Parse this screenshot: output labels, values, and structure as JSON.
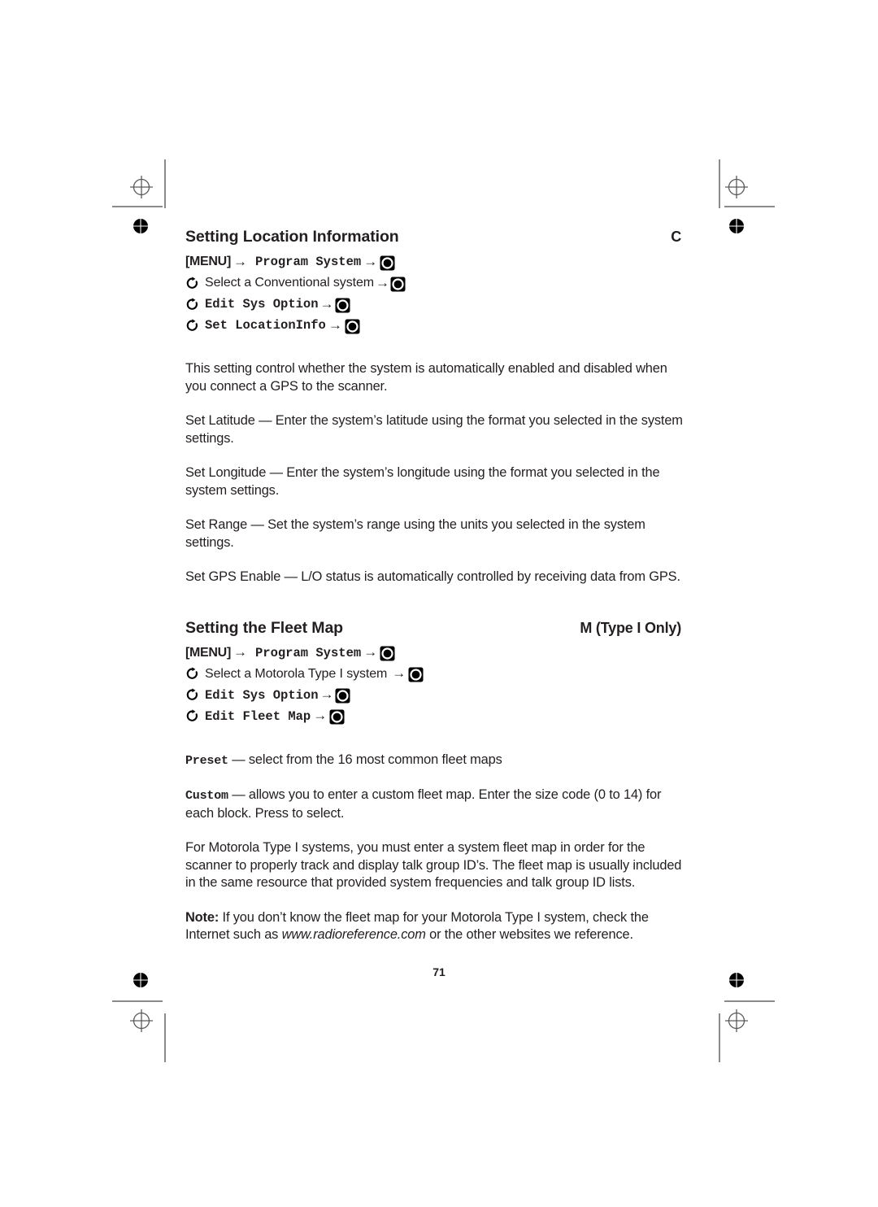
{
  "page": {
    "number": "71"
  },
  "sections": [
    {
      "title": "Setting Location Information",
      "tag": "C",
      "navpath": [
        {
          "lead": "[MENU]",
          "lead_style": "menu",
          "label": "Program System",
          "label_style": "mono"
        },
        {
          "lead": "rotate-icon",
          "lead_style": "icon",
          "label": "Select a Conventional system",
          "label_style": "plain"
        },
        {
          "lead": "rotate-icon",
          "lead_style": "icon",
          "label": "Edit Sys Option",
          "label_style": "mono"
        },
        {
          "lead": "rotate-icon",
          "lead_style": "icon",
          "label": "Set LocationInfo",
          "label_style": "mono"
        }
      ],
      "paragraphs": [
        "This setting control whether the system is automatically enabled and disabled when you connect a GPS to the scanner.",
        "Set Latitude — Enter the system’s latitude using the format you selected in the system settings.",
        "Set Longitude — Enter the system’s longitude using the format you selected in the system settings.",
        "Set Range — Set the system’s range using the units you selected in the system settings.",
        "Set GPS Enable — L/O status is automatically controlled by receiving data from GPS."
      ]
    },
    {
      "title": "Setting the Fleet Map",
      "tag": "M (Type I Only)",
      "navpath": [
        {
          "lead": "[MENU]",
          "lead_style": "menu",
          "label": "Program System",
          "label_style": "mono"
        },
        {
          "lead": "rotate-icon",
          "lead_style": "icon",
          "label": "Select a Motorola Type I system",
          "label_style": "plain"
        },
        {
          "lead": "rotate-icon",
          "lead_style": "icon",
          "label": "Edit Sys Option",
          "label_style": "mono"
        },
        {
          "lead": "rotate-icon",
          "lead_style": "icon",
          "label": "Edit Fleet Map",
          "label_style": "mono"
        }
      ],
      "definitions": [
        {
          "term": "Preset",
          "text": " — select from the 16 most common fleet maps"
        },
        {
          "term": "Custom",
          "text": " — allows you to enter a custom fleet map. Enter the size code (0 to 14) for each block. Press  to select."
        }
      ],
      "paragraphs": [
        "For Motorola Type I systems, you must enter a system fleet map in order for the scanner to properly track and display talk group ID’s. The fleet map is usually included in the same resource that provided system frequencies and talk group ID lists."
      ],
      "note": {
        "label": "Note:",
        "text_before": " If you don’t know the fleet map for your Motorola Type I system, check the Internet such as ",
        "url": "www.radioreference.com",
        "text_after": " or the other websites we reference."
      }
    }
  ],
  "icons": {
    "knob": "rotary-knob-press-icon",
    "rotate": "rotate-scroll-icon",
    "arrow": "→"
  },
  "colors": {
    "text": "#231f20",
    "crop_mark": "#8a8a8a",
    "background": "#ffffff"
  }
}
